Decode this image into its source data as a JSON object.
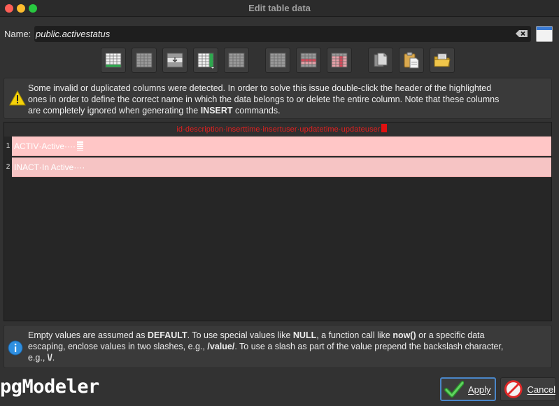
{
  "window": {
    "title": "Edit table data"
  },
  "name": {
    "label": "Name:",
    "value": "public.activestatus"
  },
  "warning": {
    "line1": "Some invalid or duplicated columns were detected. In order to solve this issue double-click the header of the highlighted",
    "line2": "ones in order to define the correct name in which the data belongs to or delete the entire column. Note that these columns",
    "line3_pre": "are completely ignored when generating the ",
    "line3_bold": "INSERT",
    "line3_post": " commands."
  },
  "table": {
    "header": "id·description·inserttime·insertuser·updatetime·updateuser",
    "rows": [
      {
        "num": "1",
        "value": "ACTIV·Active····"
      },
      {
        "num": "2",
        "value": "INACT·In Active····"
      }
    ]
  },
  "info": {
    "t1": "Empty values are assumed as ",
    "b1": "DEFAULT",
    "t2": ". To use special values like ",
    "b2": "NULL",
    "t3": ", a function call like ",
    "b3": "now()",
    "t4": " or a specific data",
    "t5": "escaping, enclose values in two slashes, e.g., ",
    "b4": "/value/",
    "t6": ". To use a slash as part of the value prepend the backslash character,",
    "t7": "e.g., ",
    "b5": "\\/",
    "t8": "."
  },
  "brand": {
    "logo": "pgModeler"
  },
  "buttons": {
    "apply": "Apply",
    "cancel": "Cancel"
  },
  "colors": {
    "accent": "#4a86c8",
    "invalid_header": "#e02020",
    "invalid_row": "#ffc6c6"
  }
}
